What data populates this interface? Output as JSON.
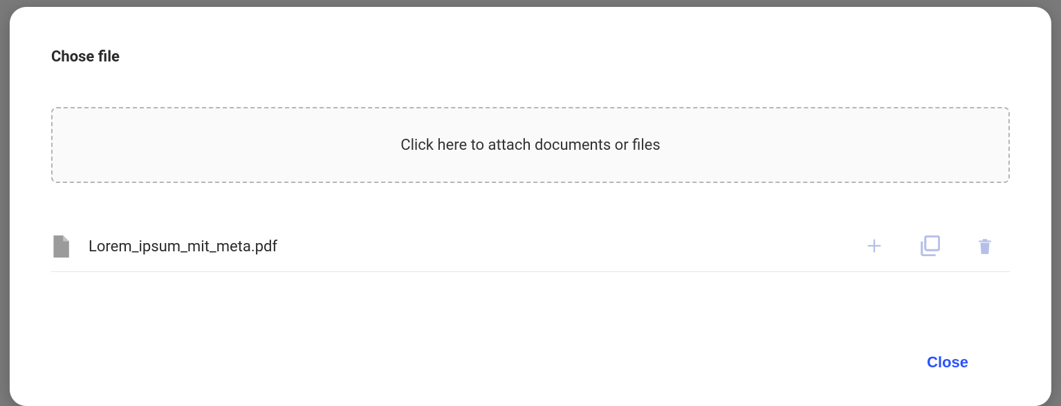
{
  "modal": {
    "title": "Chose file",
    "dropzone_text": "Click here to attach documents or files",
    "close_label": "Close"
  },
  "files": [
    {
      "name": "Lorem_ipsum_mit_meta.pdf"
    }
  ],
  "colors": {
    "primary": "#2952ff",
    "icon_muted": "#b6bfea",
    "icon_gray": "#9b9b9b",
    "text": "#2a2a2a",
    "border_dashed": "#b5b5b5"
  }
}
